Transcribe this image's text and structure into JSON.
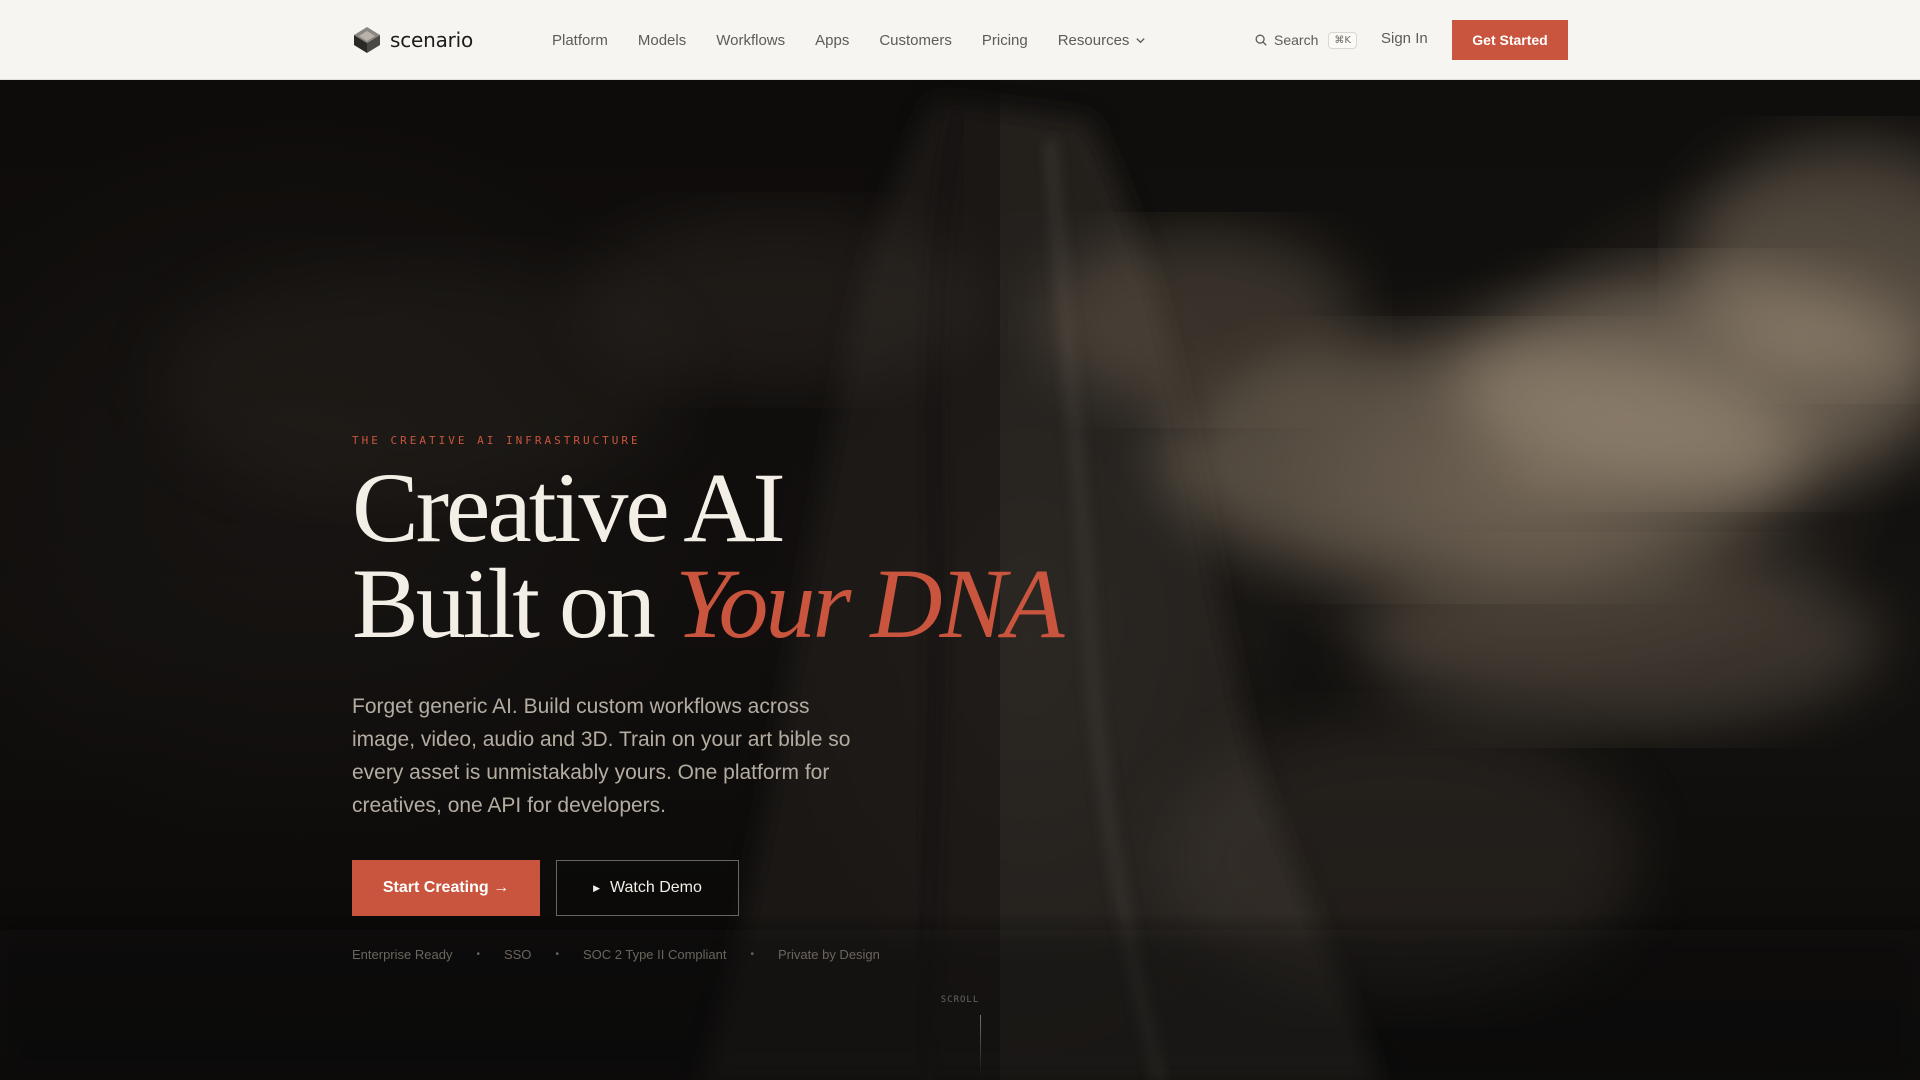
{
  "header": {
    "brand": "scenario",
    "nav": [
      {
        "label": "Platform"
      },
      {
        "label": "Models"
      },
      {
        "label": "Workflows"
      },
      {
        "label": "Apps"
      },
      {
        "label": "Customers"
      },
      {
        "label": "Pricing"
      },
      {
        "label": "Resources",
        "icon": "chevron-down-icon"
      }
    ],
    "search": {
      "label": "Search",
      "shortcut": "⌘K",
      "icon": "search-icon"
    },
    "sign_in": "Sign In",
    "cta": "Get Started"
  },
  "hero": {
    "eyebrow": "THE CREATIVE AI INFRASTRUCTURE",
    "headline_line1": "Creative AI",
    "headline_line2_plain": "Built on ",
    "headline_line2_accent": "Your DNA",
    "lede": "Forget generic AI. Build custom workflows across image, video, audio and 3D. Train on your art bible so every asset is unmistakably yours. One platform for creatives, one API for developers.",
    "primary_cta": "Start Creating →",
    "secondary_cta": "Watch Demo",
    "secondary_cta_icon": "play-icon",
    "badges": [
      "Enterprise Ready",
      "SSO",
      "SOC 2 Type II Compliant",
      "Private by Design"
    ],
    "scroll": "SCROLL"
  },
  "colors": {
    "accent": "#c9553e",
    "header_bg": "#f6f5f1",
    "hero_bg": "#100e0c",
    "headline": "#f3eee6"
  }
}
